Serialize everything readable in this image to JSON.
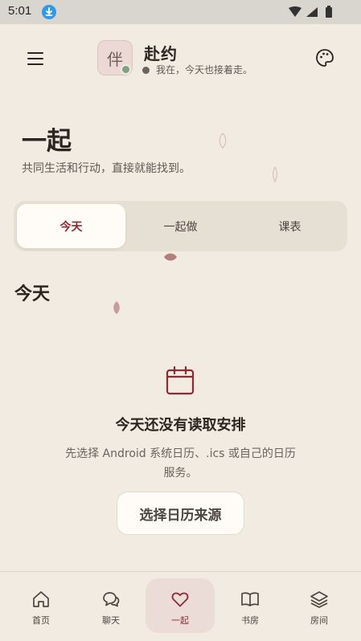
{
  "status_bar": {
    "time": "5:01"
  },
  "header": {
    "avatar_char": "伴",
    "app_title": "赴约",
    "status_text": "我在，今天也接着走。"
  },
  "hero": {
    "title": "一起",
    "subtitle": "共同生活和行动，直接就能找到。"
  },
  "tabs": [
    {
      "label": "今天",
      "active": true
    },
    {
      "label": "一起做",
      "active": false
    },
    {
      "label": "课表",
      "active": false
    }
  ],
  "section": {
    "title": "今天"
  },
  "empty_state": {
    "icon": "calendar-icon",
    "title": "今天还没有读取安排",
    "description": "先选择 Android 系统日历、.ics 或自己的日历服务。",
    "button_label": "选择日历来源"
  },
  "bottom_nav": [
    {
      "label": "首页",
      "icon": "home-icon",
      "active": false
    },
    {
      "label": "聊天",
      "icon": "chat-icon",
      "active": false
    },
    {
      "label": "一起",
      "icon": "heart-icon",
      "active": true
    },
    {
      "label": "书房",
      "icon": "book-icon",
      "active": false
    },
    {
      "label": "房间",
      "icon": "layers-icon",
      "active": false
    }
  ],
  "colors": {
    "background": "#f1ebe1",
    "accent": "#8c2a35",
    "online": "#7aa37e",
    "nav_active_bg": "#ecdcd8"
  }
}
